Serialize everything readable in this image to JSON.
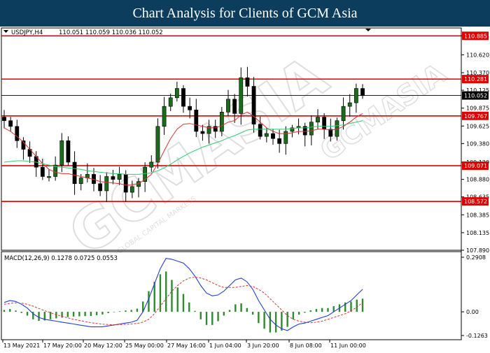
{
  "page": {
    "title": "Chart Analysis for Clients of GCM Asia"
  },
  "watermark": {
    "logo_text": "GCMASIA",
    "sub_text": "GLOBAL CAPITAL MARKETS",
    "top_right_text": "GCMASIA"
  },
  "colors": {
    "background": "#ffffff",
    "banner": "#0c3d5c",
    "resistance_line": "#e00000",
    "price_candle": "#1a6b1a",
    "ma_fast": "#e03030",
    "ma_slow": "#2ecc71",
    "macd_line": "#1f3fd6",
    "signal_line": "#e03030",
    "histogram": "#2e8b2e"
  },
  "chart_data": [
    {
      "type": "candlestick",
      "instrument_label": "USDJPY,H4",
      "ohlc_readout": "110.051 110.059 110.036 110.052",
      "ylim": [
        107.89,
        110.995
      ],
      "y_ticks": [
        "110.885",
        "110.620",
        "110.370",
        "110.125",
        "109.875",
        "109.625",
        "109.380",
        "109.120",
        "108.880",
        "108.635",
        "108.385",
        "108.135",
        "107.890"
      ],
      "x_ticks": [
        "13 May 2021",
        "17 May 20:00",
        "20 May 12:00",
        "25 May 00:00",
        "27 May 16:00",
        "1 Jun 04:00",
        "3 Jun 20:00",
        "8 Jun 08:00",
        "11 Jun 00:00"
      ],
      "current_price": 110.052,
      "current_price_label": "110.052",
      "horizontal_levels": [
        {
          "value": 110.885,
          "label": "110.885"
        },
        {
          "value": 110.281,
          "label": "110.281"
        },
        {
          "value": 109.767,
          "label": "109.767"
        },
        {
          "value": 109.071,
          "label": "109.071"
        },
        {
          "value": 108.572,
          "label": "108.572"
        }
      ],
      "price_path": [
        109.7,
        109.62,
        109.42,
        109.3,
        109.2,
        109.05,
        108.92,
        108.92,
        109.08,
        109.42,
        109.12,
        108.82,
        108.9,
        108.95,
        108.82,
        108.72,
        108.92,
        108.88,
        108.95,
        108.7,
        108.78,
        108.85,
        109.05,
        109.12,
        109.62,
        109.9,
        110.02,
        110.15,
        109.9,
        109.85,
        109.55,
        109.52,
        109.62,
        109.55,
        109.82,
        110.0,
        109.8,
        110.3,
        110.18,
        109.65,
        109.48,
        109.52,
        109.45,
        109.38,
        109.55,
        109.6,
        109.62,
        109.5,
        109.68,
        109.75,
        109.58,
        109.48,
        109.7,
        109.9,
        109.95,
        110.15,
        110.05
      ],
      "ma_fast": [
        109.6,
        109.55,
        109.48,
        109.4,
        109.3,
        109.2,
        109.1,
        109.02,
        108.98,
        108.96,
        108.96,
        108.94,
        108.92,
        108.9,
        108.88,
        108.85,
        108.84,
        108.83,
        108.82,
        108.8,
        108.8,
        108.82,
        108.88,
        108.95,
        109.1,
        109.28,
        109.45,
        109.58,
        109.65,
        109.66,
        109.64,
        109.62,
        109.6,
        109.6,
        109.63,
        109.68,
        109.7,
        109.78,
        109.82,
        109.76,
        109.68,
        109.6,
        109.55,
        109.52,
        109.52,
        109.53,
        109.55,
        109.55,
        109.56,
        109.58,
        109.58,
        109.57,
        109.58,
        109.62,
        109.68,
        109.75,
        109.8
      ],
      "ma_slow": [
        109.12,
        109.13,
        109.14,
        109.14,
        109.13,
        109.12,
        109.1,
        109.08,
        109.06,
        109.05,
        109.04,
        109.03,
        109.02,
        109.0,
        108.99,
        108.98,
        108.97,
        108.96,
        108.96,
        108.95,
        108.95,
        108.95,
        108.96,
        108.97,
        109.0,
        109.04,
        109.09,
        109.15,
        109.2,
        109.25,
        109.29,
        109.33,
        109.36,
        109.39,
        109.42,
        109.46,
        109.49,
        109.53,
        109.57,
        109.58,
        109.58,
        109.58,
        109.58,
        109.58,
        109.58,
        109.59,
        109.6,
        109.6,
        109.61,
        109.62,
        109.62,
        109.62,
        109.63,
        109.64,
        109.66,
        109.68,
        109.7
      ]
    },
    {
      "type": "macd",
      "label": "MACD(12,26,9) 0.1278 0.0725 0.0553",
      "ylim": [
        -0.1263,
        0.2908
      ],
      "y_ticks": [
        "0.2908",
        "0.00",
        "-0.1263"
      ],
      "macd_line": [
        0.05,
        0.06,
        0.055,
        0.04,
        0.02,
        -0.01,
        -0.03,
        -0.04,
        -0.045,
        -0.05,
        -0.055,
        -0.06,
        -0.065,
        -0.07,
        -0.075,
        -0.08,
        -0.08,
        -0.08,
        -0.075,
        -0.07,
        -0.065,
        -0.06,
        -0.055,
        -0.045,
        0.0,
        0.07,
        0.15,
        0.23,
        0.285,
        0.28,
        0.27,
        0.26,
        0.23,
        0.19,
        0.14,
        0.1,
        0.085,
        0.09,
        0.11,
        0.14,
        0.17,
        0.18,
        0.16,
        0.12,
        0.06,
        0.01,
        -0.04,
        -0.07,
        -0.09,
        -0.1,
        -0.08,
        -0.065,
        -0.06,
        -0.05,
        -0.04,
        -0.03,
        -0.02,
        0.0,
        0.02,
        0.04,
        0.06,
        0.09,
        0.12
      ],
      "signal_line": [
        0.04,
        0.045,
        0.048,
        0.046,
        0.04,
        0.03,
        0.018,
        0.006,
        -0.005,
        -0.015,
        -0.024,
        -0.032,
        -0.04,
        -0.046,
        -0.052,
        -0.058,
        -0.062,
        -0.066,
        -0.068,
        -0.069,
        -0.068,
        -0.067,
        -0.065,
        -0.062,
        -0.055,
        -0.04,
        -0.01,
        0.03,
        0.07,
        0.11,
        0.14,
        0.165,
        0.18,
        0.185,
        0.18,
        0.17,
        0.155,
        0.14,
        0.13,
        0.13,
        0.13,
        0.135,
        0.14,
        0.135,
        0.12,
        0.1,
        0.07,
        0.04,
        0.01,
        -0.02,
        -0.04,
        -0.05,
        -0.055,
        -0.058,
        -0.055,
        -0.05,
        -0.04,
        -0.03,
        -0.02,
        -0.01,
        0.005,
        0.025,
        0.05
      ],
      "histogram": [
        0.01,
        0.015,
        0.007,
        -0.006,
        -0.02,
        -0.04,
        -0.048,
        -0.046,
        -0.04,
        -0.035,
        -0.031,
        -0.028,
        -0.025,
        -0.024,
        -0.023,
        -0.022,
        -0.018,
        -0.014,
        -0.007,
        -0.001,
        0.003,
        0.007,
        0.01,
        0.017,
        0.055,
        0.11,
        0.16,
        0.2,
        0.215,
        0.17,
        0.13,
        0.095,
        0.05,
        0.005,
        -0.04,
        -0.07,
        -0.07,
        -0.05,
        -0.02,
        0.01,
        0.04,
        0.045,
        0.02,
        -0.015,
        -0.06,
        -0.09,
        -0.11,
        -0.11,
        -0.1,
        -0.08,
        -0.04,
        -0.015,
        -0.005,
        0.008,
        0.015,
        0.02,
        0.02,
        0.03,
        0.04,
        0.05,
        0.055,
        0.065,
        0.07
      ]
    }
  ]
}
